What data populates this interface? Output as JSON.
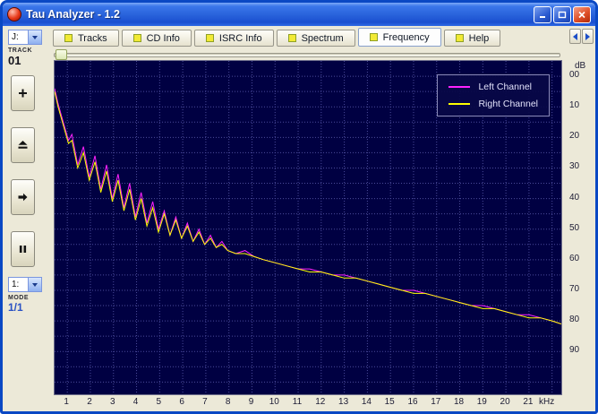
{
  "window": {
    "title": "Tau Analyzer - 1.2"
  },
  "tabs": [
    {
      "label": "Tracks",
      "active": false
    },
    {
      "label": "CD Info",
      "active": false
    },
    {
      "label": "ISRC Info",
      "active": false
    },
    {
      "label": "Spectrum",
      "active": false
    },
    {
      "label": "Frequency",
      "active": true
    },
    {
      "label": "Help",
      "active": false
    }
  ],
  "sidebar": {
    "drive_select_value": "J:",
    "track_label": "TRACK",
    "track_number": "01",
    "transport": [
      {
        "icon": "plus"
      },
      {
        "icon": "eject"
      },
      {
        "icon": "next"
      },
      {
        "icon": "pause"
      }
    ],
    "mode_select_value": "1:",
    "mode_label": "MODE",
    "mode_value": "1/1"
  },
  "chart_data": {
    "type": "line",
    "title": "",
    "xlabel": "kHz",
    "ylabel": "dB",
    "x_range": [
      0.45,
      22.4
    ],
    "y_range_db": [
      5,
      -104
    ],
    "grid": {
      "x_step": 1,
      "y_step": 5,
      "color": "#4b4b9b",
      "on": true
    },
    "background": "#000042",
    "legend_position": "top-right",
    "x_tick_values": [
      1,
      2,
      3,
      4,
      5,
      6,
      7,
      8,
      9,
      10,
      11,
      12,
      13,
      14,
      15,
      16,
      17,
      18,
      19,
      20,
      21
    ],
    "x_tick_labels": [
      "1",
      "2",
      "3",
      "4",
      "5",
      "6",
      "7",
      "8",
      "9",
      "10",
      "11",
      "12",
      "13",
      "14",
      "15",
      "16",
      "17",
      "18",
      "19",
      "20",
      "21"
    ],
    "y_tick_values": [
      0,
      -10,
      -20,
      -30,
      -40,
      -50,
      -60,
      -70,
      -80,
      -90
    ],
    "y_tick_labels": [
      "00",
      "10",
      "20",
      "30",
      "40",
      "50",
      "60",
      "70",
      "80",
      "90"
    ],
    "x": [
      0.45,
      0.6,
      0.75,
      0.9,
      1.05,
      1.2,
      1.45,
      1.7,
      1.95,
      2.2,
      2.45,
      2.7,
      2.95,
      3.2,
      3.45,
      3.7,
      3.95,
      4.2,
      4.45,
      4.7,
      4.95,
      5.2,
      5.45,
      5.7,
      5.95,
      6.2,
      6.45,
      6.7,
      6.95,
      7.2,
      7.45,
      7.7,
      7.95,
      8.3,
      8.7,
      9.1,
      9.5,
      10,
      10.5,
      11,
      11.5,
      12,
      12.5,
      13,
      13.5,
      14,
      14.5,
      15,
      15.5,
      16,
      16.5,
      17,
      17.5,
      18,
      18.5,
      19,
      19.5,
      20,
      20.5,
      21,
      21.5,
      22,
      22.4
    ],
    "series": [
      {
        "name": "Left Channel",
        "color": "#ff22ff",
        "values": [
          -4,
          -9,
          -13,
          -17,
          -21,
          -19,
          -29,
          -23,
          -33,
          -26,
          -37,
          -29,
          -40,
          -32,
          -43,
          -35,
          -46,
          -38,
          -48,
          -41,
          -50,
          -44,
          -52,
          -46,
          -53,
          -48,
          -54,
          -50,
          -55,
          -52,
          -56,
          -54,
          -57,
          -58,
          -57,
          -59,
          -60,
          -61,
          -62,
          -63,
          -63,
          -64,
          -65,
          -65,
          -66,
          -67,
          -68,
          -69,
          -70,
          -70,
          -71,
          -72,
          -73,
          -74,
          -75,
          -75,
          -76,
          -77,
          -78,
          -78,
          -79,
          -80,
          -81
        ]
      },
      {
        "name": "Right Channel",
        "color": "#ffff00",
        "values": [
          -5,
          -10,
          -14,
          -18,
          -22,
          -21,
          -30,
          -25,
          -34,
          -28,
          -38,
          -31,
          -41,
          -34,
          -44,
          -37,
          -47,
          -40,
          -49,
          -43,
          -51,
          -45,
          -52,
          -47,
          -53,
          -49,
          -54,
          -51,
          -55,
          -53,
          -56,
          -55,
          -57,
          -58,
          -58,
          -59,
          -60,
          -61,
          -62,
          -63,
          -64,
          -64,
          -65,
          -66,
          -66,
          -67,
          -68,
          -69,
          -70,
          -71,
          -71,
          -72,
          -73,
          -74,
          -75,
          -76,
          -76,
          -77,
          -78,
          -79,
          -79,
          -80,
          -81
        ]
      }
    ]
  },
  "colors": {
    "titlebar_blue": "#2a64dc",
    "window_bg": "#ece9d8",
    "plot_bg": "#000042",
    "grid": "#4b4b9b",
    "left_channel": "#ff22ff",
    "right_channel": "#ffff00",
    "close_red": "#d43818"
  }
}
